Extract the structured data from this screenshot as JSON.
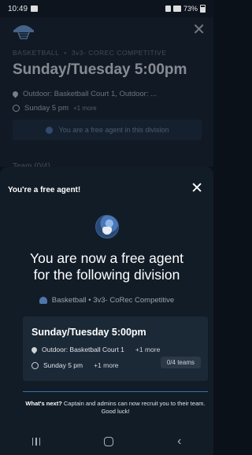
{
  "status_bar": {
    "time": "10:49",
    "battery": "73%"
  },
  "background_page": {
    "crumb_sport": "BASKETBALL",
    "crumb_sep": "•",
    "crumb_division": "3v3- COREC COMPETITIVE",
    "title": "Sunday/Tuesday 5:00pm",
    "location": "Outdoor: Basketball Court 1, Outdoor: ...",
    "schedule": "Sunday 5 pm",
    "schedule_more": "+1 more",
    "agent_text": "You are a free agent in this division",
    "peek_text": "Team (0/4)"
  },
  "sheet": {
    "title": "You're a free agent!",
    "close": "✕",
    "headline_line1": "You are now a free agent",
    "headline_line2": "for the following division",
    "division_label": "Basketball • 3v3- CoRec Competitive",
    "card": {
      "title": "Sunday/Tuesday 5:00pm",
      "location": "Outdoor: Basketball Court 1",
      "location_more": "+1 more",
      "schedule": "Sunday 5 pm",
      "schedule_more": "+1 more",
      "teams": "0/4 teams"
    },
    "whats_next_label": "What's next?",
    "whats_next_text": "Captain and admins can now recruit you to their team. Good luck!"
  },
  "nav": {
    "back": "‹"
  },
  "colors": {
    "accent": "#4f76ab",
    "sheet_bg": "#121c27",
    "card_bg": "#1b2836"
  }
}
